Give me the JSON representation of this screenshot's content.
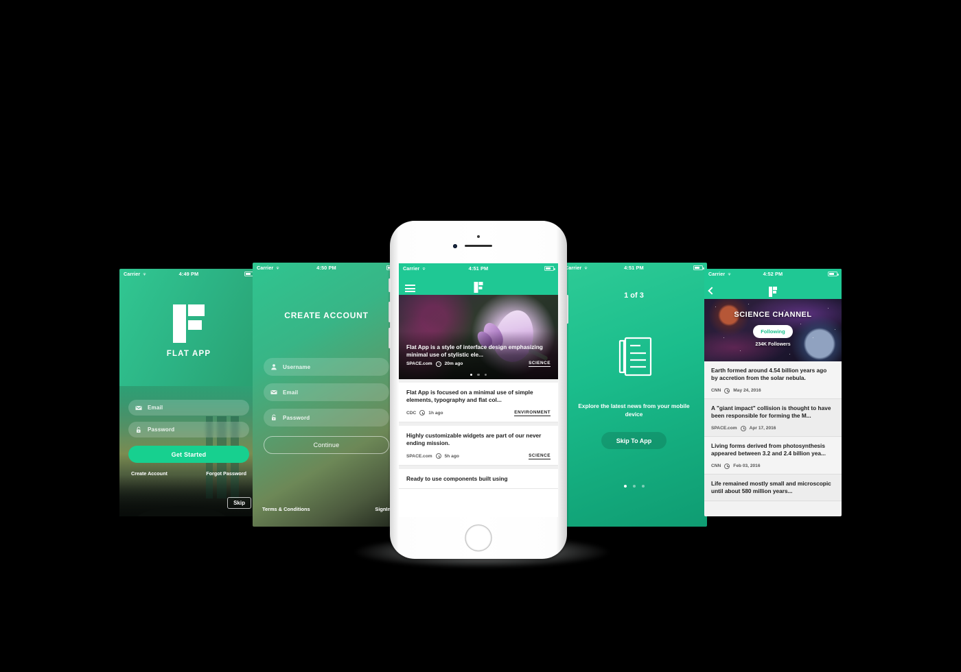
{
  "brand": {
    "name": "FLAT APP",
    "logo_icon": "f-logo-icon",
    "accent": "#1fc894"
  },
  "screen_login": {
    "status": {
      "carrier": "Carrier",
      "wifi_icon": "wifi-icon",
      "time": "4:49 PM",
      "battery_icon": "battery-icon"
    },
    "title": "FLAT APP",
    "email_field": {
      "icon": "envelope-icon",
      "placeholder": "Email",
      "value": ""
    },
    "password_field": {
      "icon": "lock-icon",
      "placeholder": "Password",
      "value": ""
    },
    "primary_button": "Get Started",
    "create_account_link": "Create Account",
    "forgot_password_link": "Forgot Password",
    "skip_button": "Skip"
  },
  "screen_create": {
    "status": {
      "carrier": "Carrier",
      "wifi_icon": "wifi-icon",
      "time": "4:50 PM",
      "battery_icon": "battery-icon"
    },
    "title": "CREATE ACCOUNT",
    "username_field": {
      "icon": "user-icon",
      "placeholder": "Username",
      "value": ""
    },
    "email_field": {
      "icon": "envelope-icon",
      "placeholder": "Email",
      "value": ""
    },
    "password_field": {
      "icon": "lock-icon",
      "placeholder": "Password",
      "value": ""
    },
    "continue_button": "Continue",
    "terms_link": "Terms & Conditions",
    "signin_link": "SignIn"
  },
  "screen_feed": {
    "status": {
      "carrier": "Carrier",
      "wifi_icon": "wifi-icon",
      "time": "4:51 PM",
      "battery_icon": "battery-icon"
    },
    "menu_icon": "hamburger-menu-icon",
    "logo_icon": "f-logo-icon",
    "hero": {
      "title": "Flat App is a style of interface design emphasizing minimal use of stylistic ele...",
      "source": "SPACE.com",
      "time": "20m ago",
      "clock_icon": "clock-icon",
      "tag": "SCIENCE",
      "carousel_dots": 3,
      "carousel_active": 0
    },
    "articles": [
      {
        "title": "Flat App is focused on a minimal use of simple elements, typography and flat col...",
        "source": "CDC",
        "time": "1h ago",
        "tag": "ENVIRONMENT"
      },
      {
        "title": "Highly customizable widgets are part of our never ending mission.",
        "source": "SPACE.com",
        "time": "5h ago",
        "tag": "SCIENCE"
      },
      {
        "title": "Ready to use components built using",
        "source": "",
        "time": "",
        "tag": ""
      }
    ]
  },
  "screen_onboarding": {
    "status": {
      "carrier": "Carrier",
      "wifi_icon": "wifi-icon",
      "time": "4:51 PM",
      "battery_icon": "battery-icon"
    },
    "step_label": "1 of 3",
    "illustration_icon": "document-lines-icon",
    "subtitle": "Explore the latest news from your mobile device",
    "skip_button": "Skip To App",
    "pager_dots": 3,
    "pager_active": 0
  },
  "screen_channel": {
    "status": {
      "carrier": "Carrier",
      "wifi_icon": "wifi-icon",
      "time": "4:52 PM",
      "battery_icon": "battery-icon"
    },
    "back_icon": "chevron-left-icon",
    "logo_icon": "f-logo-icon",
    "channel_name": "SCIENCE CHANNEL",
    "follow_button": "Following",
    "followers": "234K Followers",
    "articles": [
      {
        "title": "Earth formed around 4.54 billion years ago by accretion from the solar nebula.",
        "source": "CNN",
        "date": "May 24, 2016"
      },
      {
        "title": " A \"giant impact\" collision is thought to have been responsible for forming the M...",
        "source": "SPACE.com",
        "date": "Apr 17, 2016"
      },
      {
        "title": "Living forms derived from photosynthesis appeared between 3.2 and 2.4 billion yea...",
        "source": "CNN",
        "date": "Feb 03, 2016"
      },
      {
        "title": "Life remained mostly small and microscopic until about 580 million years...",
        "source": "",
        "date": ""
      }
    ]
  }
}
